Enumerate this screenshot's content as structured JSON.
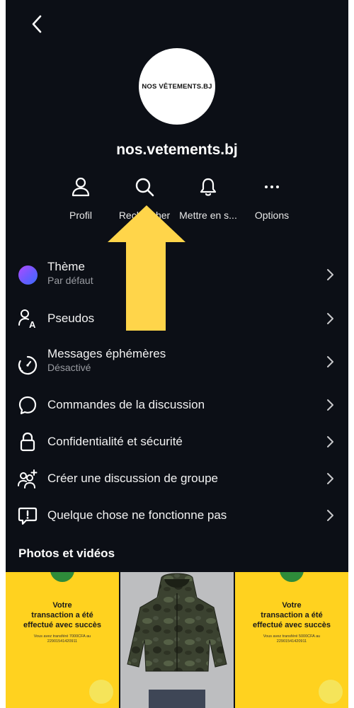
{
  "profile": {
    "avatar_text": "NOS VÊTEMENTS.BJ",
    "username": "nos.vetements.bj"
  },
  "actions": [
    {
      "label": "Profil",
      "icon": "person-icon"
    },
    {
      "label": "Rechercher",
      "icon": "search-icon"
    },
    {
      "label": "Mettre en s...",
      "icon": "bell-icon"
    },
    {
      "label": "Options",
      "icon": "more-icon"
    }
  ],
  "menu": {
    "theme": {
      "title": "Thème",
      "subtitle": "Par défaut"
    },
    "nicknames": {
      "title": "Pseudos"
    },
    "disappearing": {
      "title": "Messages éphémères",
      "subtitle": "Désactivé"
    },
    "commands": {
      "title": "Commandes de la discussion"
    },
    "privacy": {
      "title": "Confidentialité et sécurité"
    },
    "group": {
      "title": "Créer une discussion de groupe"
    },
    "problem": {
      "title": "Quelque chose ne fonctionne pas"
    }
  },
  "media": {
    "section_title": "Photos et vidéos",
    "tiles": [
      {
        "headline_1": "Votre",
        "headline_2": "transaction a été",
        "headline_3": "effectué avec succès",
        "detail_1": "Vous avez transféré 7000CFA au",
        "detail_2": "22901541420911"
      },
      {
        "kind": "photo"
      },
      {
        "headline_1": "Votre",
        "headline_2": "transaction a été",
        "headline_3": "effectué avec succès",
        "detail_1": "Vous avez transféré 5000CFA au",
        "detail_2": "22901541420911"
      }
    ]
  },
  "colors": {
    "background": "#0c0f16",
    "arrow": "#ffd54a",
    "tile_yellow": "#ffd21f",
    "theme_gradient_start": "#a94bff",
    "theme_gradient_end": "#3b6cff"
  }
}
